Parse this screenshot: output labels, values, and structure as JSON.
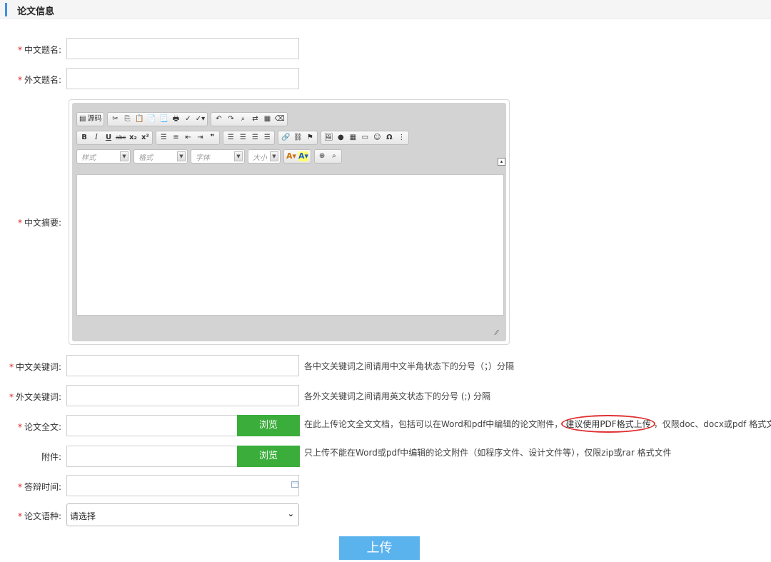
{
  "section": {
    "title": "论文信息"
  },
  "required_mark": "*",
  "fields": {
    "cn_title": {
      "label": "中文题名:",
      "value": ""
    },
    "en_title": {
      "label": "外文题名:",
      "value": ""
    },
    "cn_abstract": {
      "label": "中文摘要:"
    },
    "cn_keywords": {
      "label": "中文关键词:",
      "value": "",
      "hint": "各中文关键词之间请用中文半角状态下的分号（；）分隔"
    },
    "en_keywords": {
      "label": "外文关键词:",
      "value": "",
      "hint": "各外文关键词之间请用英文状态下的分号 (;) 分隔"
    },
    "fulltext": {
      "label": "论文全文:",
      "button": "浏览",
      "hint_before": "在此上传论文全文文档，包括可以在Word和pdf中编辑的论文附件，",
      "hint_circled": "建议使用PDF格式上传",
      "hint_after": "，仅限doc、docx或pdf 格式文件"
    },
    "attachment": {
      "label": "附件:",
      "button": "浏览",
      "hint": "只上传不能在Word或pdf中编辑的论文附件（如程序文件、设计文件等），仅限zip或rar 格式文件"
    },
    "defense_time": {
      "label": "答辩时间:",
      "value": ""
    },
    "language": {
      "label": "论文语种:",
      "selected": "请选择"
    }
  },
  "editor": {
    "source_label": "源码",
    "font_style": "样式",
    "format": "格式",
    "font": "字体",
    "size": "大小"
  },
  "submit": {
    "label": "上传"
  },
  "colors": {
    "accent": "#3f8fe6",
    "browse": "#3aad3a",
    "upload": "#5bb3ee",
    "required": "#e02020",
    "annotation": "#e03030"
  }
}
